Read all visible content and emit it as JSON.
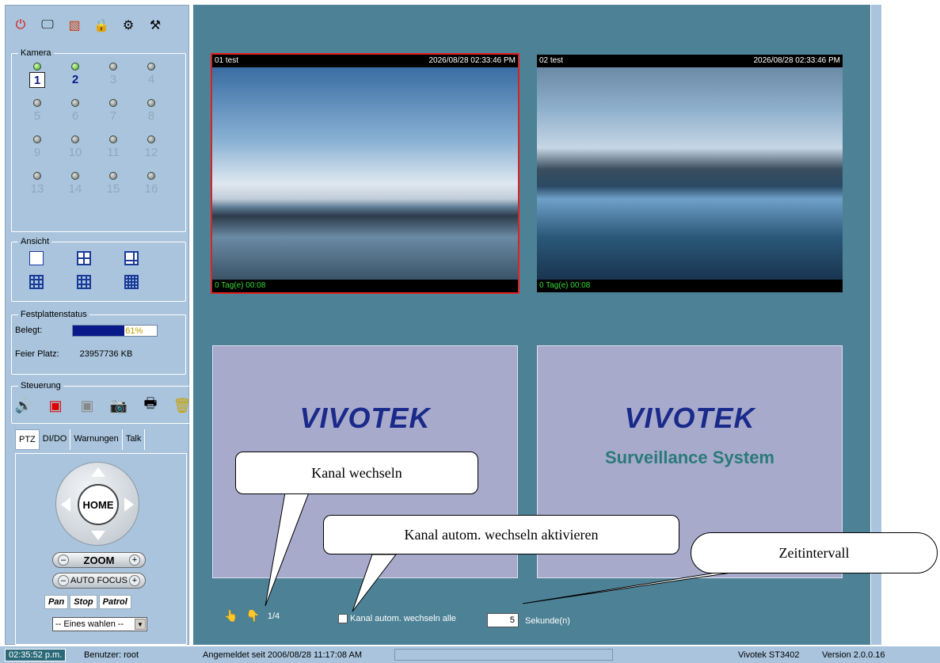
{
  "toolbar": {
    "icons": [
      "power-icon",
      "monitor-icon",
      "color-icon",
      "lock-icon",
      "settings-icon",
      "tools-icon"
    ]
  },
  "kamera": {
    "legend": "Kamera",
    "cams": [
      {
        "num": "1",
        "state": "on",
        "active": true,
        "selected": true
      },
      {
        "num": "2",
        "state": "on",
        "active": true,
        "selected": false
      },
      {
        "num": "3",
        "state": "off"
      },
      {
        "num": "4",
        "state": "off"
      },
      {
        "num": "5",
        "state": "off"
      },
      {
        "num": "6",
        "state": "off"
      },
      {
        "num": "7",
        "state": "off"
      },
      {
        "num": "8",
        "state": "off"
      },
      {
        "num": "9",
        "state": "off"
      },
      {
        "num": "10",
        "state": "off"
      },
      {
        "num": "11",
        "state": "off"
      },
      {
        "num": "12",
        "state": "off"
      },
      {
        "num": "13",
        "state": "off"
      },
      {
        "num": "14",
        "state": "off"
      },
      {
        "num": "15",
        "state": "off"
      },
      {
        "num": "16",
        "state": "off"
      }
    ]
  },
  "ansicht": {
    "legend": "Ansicht"
  },
  "disk": {
    "legend": "Festplattenstatus",
    "used_label": "Belegt:",
    "used_fraction": 0.61,
    "used_text": "61%",
    "free_label": "Feier Platz:",
    "free_value": "23957736 KB"
  },
  "steuerung": {
    "legend": "Steuerung"
  },
  "tabs": [
    "PTZ",
    "DI/DO",
    "Warnungen",
    "Talk"
  ],
  "ptz": {
    "home": "HOME",
    "zoom": "ZOOM",
    "autofocus": "AUTO FOCUS",
    "minus": "–",
    "plus": "+",
    "pan": "Pan",
    "stop": "Stop",
    "patrol": "Patrol",
    "select": "-- Eines wahlen --"
  },
  "tiles": [
    {
      "channel": "01  test",
      "time": "2026/08/28 02:33:46 PM",
      "footer": "0 Tag(e) 00:08"
    },
    {
      "channel": "02  test",
      "time": "2026/08/28 02:33:46 PM",
      "footer": "0 Tag(e) 00:08"
    }
  ],
  "logo": {
    "brand": "VIVOTEK",
    "sub": "Surveillance System"
  },
  "paging": {
    "page": "1/4",
    "auto_label": "Kanal autom. wechseln alle",
    "interval": "5",
    "unit": "Sekunde(n)"
  },
  "callouts": {
    "channel": "Kanal wechseln",
    "auto": "Kanal autom. wechseln aktivieren",
    "interval": "Zeitintervall"
  },
  "status": {
    "clock": "02:35:52 p.m.",
    "user": "Benutzer: root",
    "login": "Angemeldet seit  2006/08/28 11:17:08 AM",
    "model": "Vivotek ST3402",
    "version": "Version 2.0.0.16"
  },
  "colors": {
    "panel": "#a9c4dc",
    "main": "#4d8296",
    "selected": "#e02020"
  }
}
